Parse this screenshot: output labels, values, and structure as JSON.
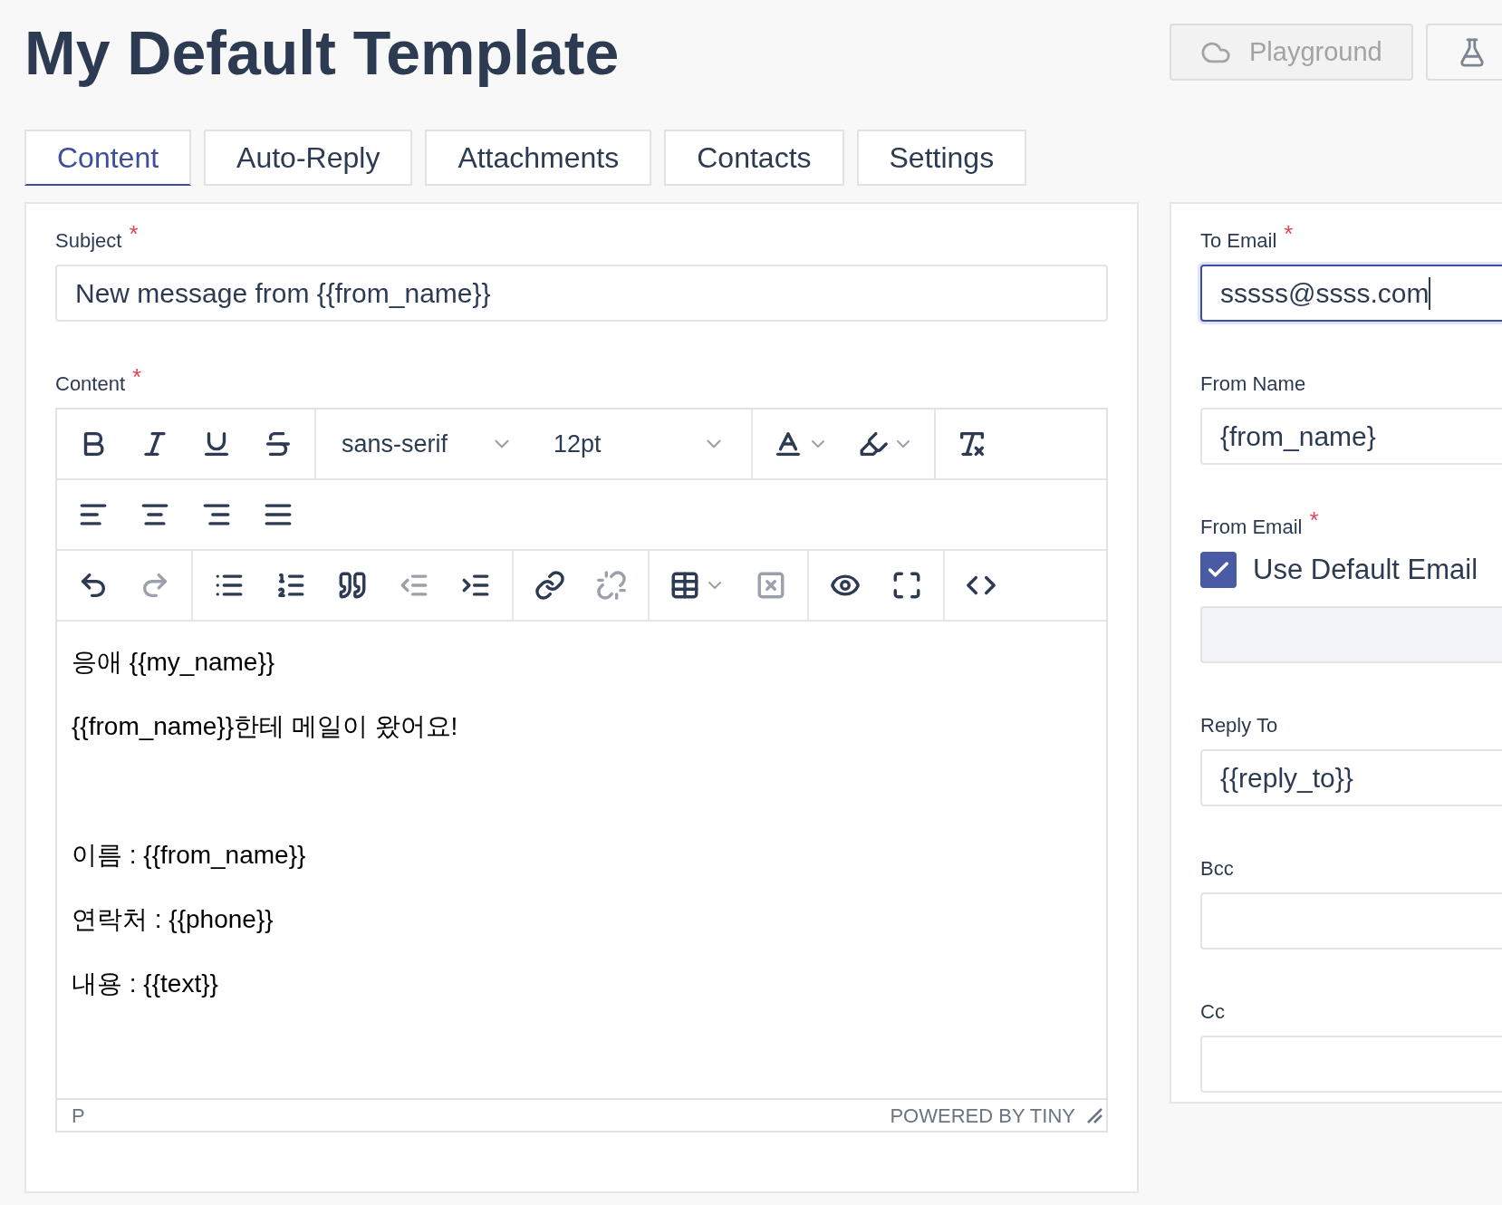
{
  "title": "My Default Template",
  "header_buttons": [
    {
      "label": "Playground",
      "kind": "cloud",
      "disabled": true
    },
    {
      "kind": "flask",
      "disabled": false
    }
  ],
  "tabs": [
    {
      "label": "Content",
      "selected": true
    },
    {
      "label": "Auto-Reply",
      "selected": false
    },
    {
      "label": "Attachments",
      "selected": false
    },
    {
      "label": "Contacts",
      "selected": false
    },
    {
      "label": "Settings",
      "selected": false
    }
  ],
  "subject": {
    "label": "Subject",
    "mark": "*",
    "value": "New message from {{from_name}}"
  },
  "content_label": {
    "label": "Content",
    "mark": "*"
  },
  "editor": {
    "toolbar_rows": [
      {
        "groups": [
          {
            "items": [
              {
                "kind": "bold",
                "disabled": false
              },
              {
                "kind": "italic",
                "disabled": false
              },
              {
                "kind": "underline",
                "disabled": false
              },
              {
                "kind": "strike",
                "disabled": false
              }
            ]
          },
          {
            "items": [
              {
                "kind": "select",
                "value": "sans-serif",
                "disabled": false
              },
              {
                "kind": "select",
                "value": "12pt",
                "disabled": false
              }
            ]
          },
          {
            "items": [
              {
                "kind": "textcolor",
                "disabled": false
              },
              {
                "kind": "highlight",
                "disabled": false
              }
            ]
          },
          {
            "items": [
              {
                "kind": "clearformat",
                "disabled": false
              }
            ]
          }
        ]
      },
      {
        "groups": [
          {
            "items": [
              {
                "kind": "alignleft",
                "disabled": false
              },
              {
                "kind": "aligncenter",
                "disabled": false
              },
              {
                "kind": "alignright",
                "disabled": false
              },
              {
                "kind": "alignjustify",
                "disabled": false
              }
            ]
          }
        ]
      },
      {
        "groups": [
          {
            "items": [
              {
                "kind": "undo",
                "disabled": false
              },
              {
                "kind": "redo",
                "disabled": true
              }
            ]
          },
          {
            "items": [
              {
                "kind": "bullist",
                "disabled": false
              },
              {
                "kind": "numlist",
                "disabled": false
              },
              {
                "kind": "blockquote",
                "disabled": false
              },
              {
                "kind": "outdent",
                "disabled": true
              },
              {
                "kind": "indent",
                "disabled": false
              }
            ]
          },
          {
            "items": [
              {
                "kind": "link",
                "disabled": false
              },
              {
                "kind": "unlink",
                "disabled": true
              }
            ]
          },
          {
            "items": [
              {
                "kind": "table",
                "disabled": false
              },
              {
                "kind": "deletetable",
                "disabled": true
              }
            ]
          },
          {
            "items": [
              {
                "kind": "preview",
                "disabled": false
              },
              {
                "kind": "fullscreen",
                "disabled": false
              }
            ]
          },
          {
            "items": [
              {
                "kind": "code",
                "disabled": false
              }
            ]
          }
        ]
      }
    ],
    "paragraphs": [
      {
        "kind": "text",
        "text": "응애 {{my_name}}"
      },
      {
        "kind": "text",
        "text": "{{from_name}}한테 메일이 왔어요!"
      },
      {
        "kind": "blank"
      },
      {
        "kind": "text",
        "text": "이름 : {{from_name}}"
      },
      {
        "kind": "text",
        "text": "연락처 : {{phone}}"
      },
      {
        "kind": "text",
        "text": "내용 : {{text}}"
      }
    ],
    "status_path": "P",
    "branding": "POWERED BY TINY"
  },
  "side_fields": [
    {
      "kind": "text",
      "label": "To Email",
      "mark": "*",
      "value": "sssss@ssss.com",
      "focused": true
    },
    {
      "kind": "text",
      "label": "From Name",
      "value": "{from_name}",
      "focused": false
    },
    {
      "kind": "checkbox",
      "label": "From Email",
      "mark": "*",
      "checkbox_label": "Use Default Email",
      "checked": true
    },
    {
      "kind": "text",
      "label": "Reply To",
      "value": "{{reply_to}}",
      "focused": false
    },
    {
      "kind": "text",
      "label": "Bcc",
      "focused": false
    },
    {
      "kind": "text",
      "label": "Cc",
      "focused": false
    }
  ]
}
